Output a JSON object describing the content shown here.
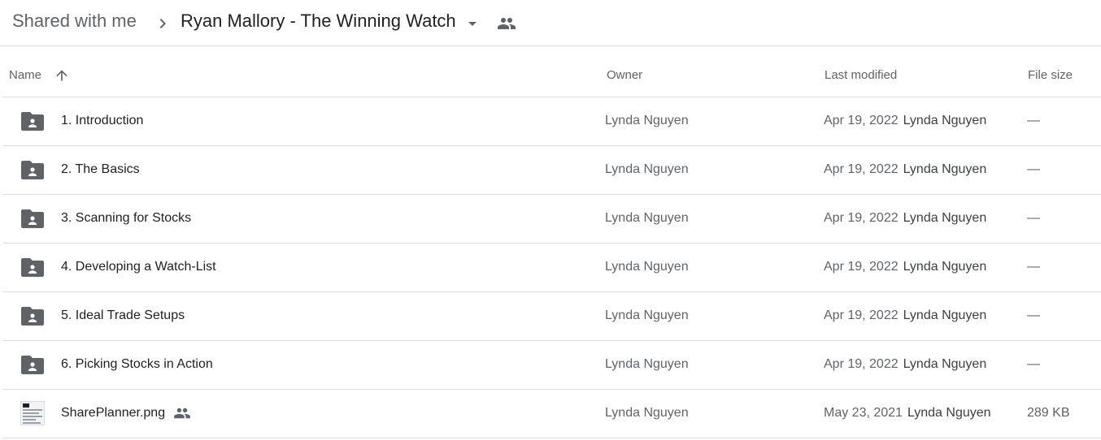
{
  "breadcrumb": {
    "root": "Shared with me",
    "current": "Ryan Mallory - The Winning Watch"
  },
  "icons": {
    "separator": "chevron-right-icon",
    "dropdown": "arrow-drop-down-icon",
    "shared": "people-icon",
    "sort": "arrow-upward-icon",
    "folder": "shared-folder-icon",
    "image": "image-thumbnail-icon"
  },
  "colors": {
    "icon": "#5f6368",
    "divider": "#dadce0",
    "text_primary": "#202124",
    "text_secondary": "#5f6368"
  },
  "columns": {
    "name": "Name",
    "owner": "Owner",
    "last_modified": "Last modified",
    "file_size": "File size"
  },
  "files": [
    {
      "name": "1. Introduction",
      "type": "folder",
      "owner": "Lynda Nguyen",
      "modified_date": "Apr 19, 2022",
      "modified_by": "Lynda Nguyen",
      "size": "—"
    },
    {
      "name": "2. The Basics",
      "type": "folder",
      "owner": "Lynda Nguyen",
      "modified_date": "Apr 19, 2022",
      "modified_by": "Lynda Nguyen",
      "size": "—"
    },
    {
      "name": "3. Scanning for Stocks",
      "type": "folder",
      "owner": "Lynda Nguyen",
      "modified_date": "Apr 19, 2022",
      "modified_by": "Lynda Nguyen",
      "size": "—"
    },
    {
      "name": "4. Developing a Watch-List",
      "type": "folder",
      "owner": "Lynda Nguyen",
      "modified_date": "Apr 19, 2022",
      "modified_by": "Lynda Nguyen",
      "size": "—"
    },
    {
      "name": "5. Ideal Trade Setups",
      "type": "folder",
      "owner": "Lynda Nguyen",
      "modified_date": "Apr 19, 2022",
      "modified_by": "Lynda Nguyen",
      "size": "—"
    },
    {
      "name": "6. Picking Stocks in Action",
      "type": "folder",
      "owner": "Lynda Nguyen",
      "modified_date": "Apr 19, 2022",
      "modified_by": "Lynda Nguyen",
      "size": "—"
    },
    {
      "name": "SharePlanner.png",
      "type": "image",
      "shared": true,
      "owner": "Lynda Nguyen",
      "modified_date": "May 23, 2021",
      "modified_by": "Lynda Nguyen",
      "size": "289 KB"
    }
  ]
}
